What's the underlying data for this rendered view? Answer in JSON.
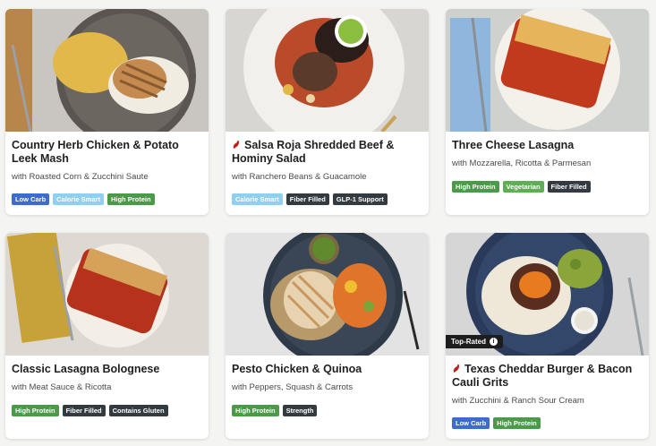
{
  "tag_colors": {
    "Low Carb": {
      "bg": "#3e6ccc",
      "fg": "#ffffff"
    },
    "Calorie Smart": {
      "bg": "#8fd0f0",
      "fg": "#ffffff"
    },
    "High Protein": {
      "bg": "#4a9a4a",
      "fg": "#ffffff"
    },
    "Fiber Filled": {
      "bg": "#333a40",
      "fg": "#ffffff"
    },
    "GLP-1 Support": {
      "bg": "#333a40",
      "fg": "#ffffff"
    },
    "Vegetarian": {
      "bg": "#5fae55",
      "fg": "#ffffff"
    },
    "Contains Gluten": {
      "bg": "#333a40",
      "fg": "#ffffff"
    },
    "Strength": {
      "bg": "#333a40",
      "fg": "#ffffff"
    }
  },
  "cards": [
    {
      "title": "Country Herb Chicken & Potato Leek Mash",
      "subtitle": "with Roasted Corn & Zucchini Saute",
      "spicy": false,
      "tags": [
        "Low Carb",
        "Calorie Smart",
        "High Protein"
      ]
    },
    {
      "title": "Salsa Roja Shredded Beef & Hominy Salad",
      "subtitle": "with Ranchero Beans & Guacamole",
      "spicy": true,
      "tags": [
        "Calorie Smart",
        "Fiber Filled",
        "GLP-1 Support"
      ]
    },
    {
      "title": "Three Cheese Lasagna",
      "subtitle": "with Mozzarella, Ricotta & Parmesan",
      "spicy": false,
      "tags": [
        "High Protein",
        "Vegetarian",
        "Fiber Filled"
      ]
    },
    {
      "title": "Classic Lasagna Bolognese",
      "subtitle": "with Meat Sauce & Ricotta",
      "spicy": false,
      "tags": [
        "High Protein",
        "Fiber Filled",
        "Contains Gluten"
      ]
    },
    {
      "title": "Pesto Chicken & Quinoa",
      "subtitle": "with Peppers, Squash & Carrots",
      "spicy": false,
      "tags": [
        "High Protein",
        "Strength"
      ]
    },
    {
      "title": "Texas Cheddar Burger & Bacon Cauli Grits",
      "subtitle": "with Zucchini & Ranch Sour Cream",
      "spicy": true,
      "badge": "Top-Rated",
      "badge_icon": "info-icon",
      "tags": [
        "Low Carb",
        "High Protein"
      ]
    }
  ]
}
